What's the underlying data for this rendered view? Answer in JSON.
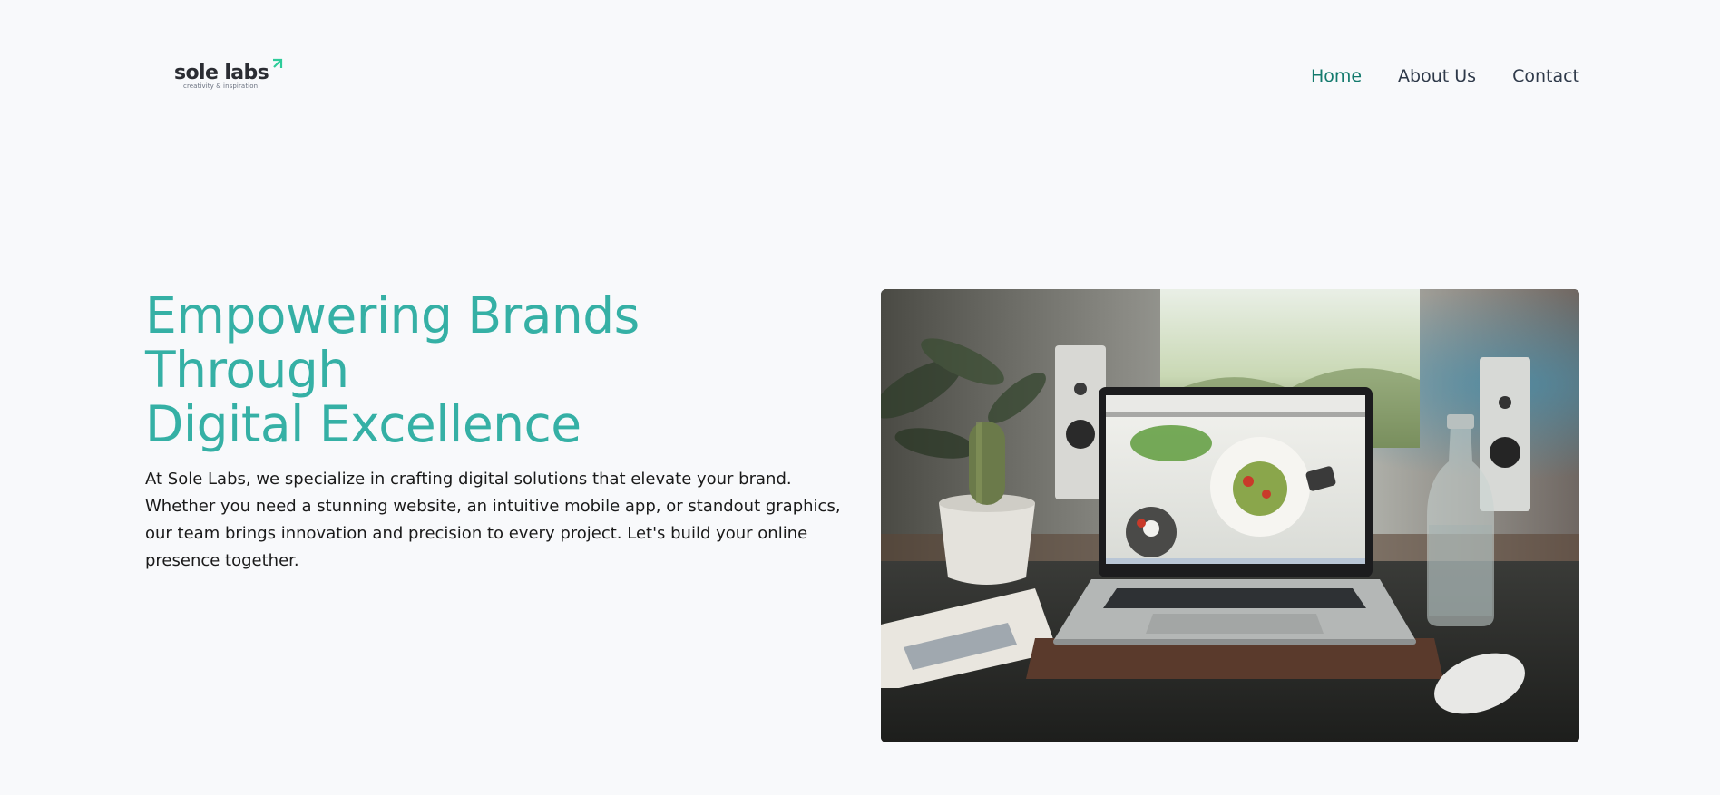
{
  "header": {
    "logo": {
      "name": "sole labs",
      "tagline": "creativity & inspiration",
      "icon": "arrow-up-right-icon",
      "accent_color": "#2ecc9a"
    },
    "nav": [
      {
        "label": "Home",
        "active": true
      },
      {
        "label": "About Us",
        "active": false
      },
      {
        "label": "Contact",
        "active": false
      }
    ]
  },
  "hero": {
    "title_line1": "Empowering Brands Through",
    "title_line2": "Digital Excellence",
    "description": "At Sole Labs, we specialize in crafting digital solutions that elevate your brand. Whether you need a stunning website, an intuitive mobile app, or standout graphics, our team brings innovation and precision to every project. Let's build your online presence together.",
    "image": "laptop-on-desk-photo"
  },
  "colors": {
    "background": "#f8f9fb",
    "title": "#35b0a5",
    "nav_active": "#137a6d",
    "nav_default": "#2f3a4a",
    "text": "#1a1a1a"
  }
}
